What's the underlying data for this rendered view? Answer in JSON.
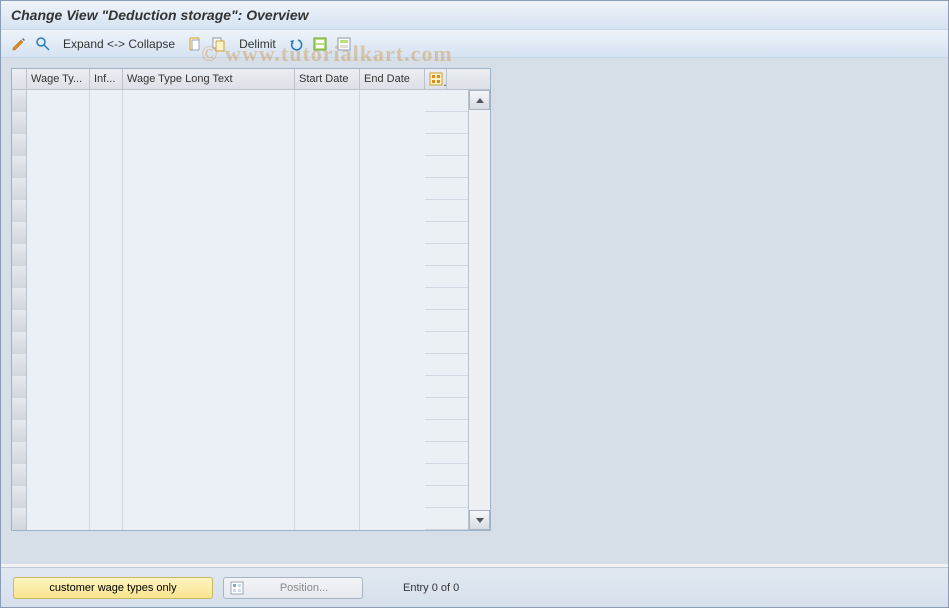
{
  "title": "Change View \"Deduction storage\": Overview",
  "toolbar": {
    "expand_collapse": "Expand <-> Collapse",
    "delimit": "Delimit"
  },
  "table": {
    "columns": {
      "wage_type": "Wage Ty...",
      "inf": "Inf...",
      "wage_type_long": "Wage Type Long Text",
      "start_date": "Start Date",
      "end_date": "End Date"
    },
    "row_count_visible": 20
  },
  "footer": {
    "customer_btn": "customer wage types only",
    "position_btn": "Position...",
    "entry_text": "Entry 0 of 0"
  },
  "watermark": "© www.tutorialkart.com"
}
